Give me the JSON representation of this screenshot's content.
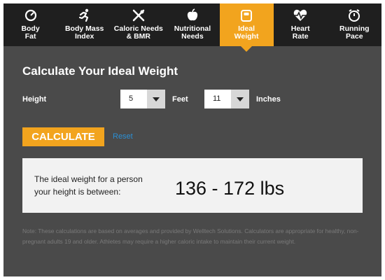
{
  "tabs": [
    {
      "label": "Body\nFat",
      "icon": "scale-icon"
    },
    {
      "label": "Body Mass\nIndex",
      "icon": "runner-icon"
    },
    {
      "label": "Caloric Needs\n& BMR",
      "icon": "utensils-icon"
    },
    {
      "label": "Nutritional\nNeeds",
      "icon": "apple-icon"
    },
    {
      "label": "Ideal\nWeight",
      "icon": "weight-scale-icon",
      "active": true
    },
    {
      "label": "Heart\nRate",
      "icon": "heart-pulse-icon"
    },
    {
      "label": "Running\nPace",
      "icon": "stopwatch-icon"
    }
  ],
  "main": {
    "title": "Calculate Your Ideal Weight",
    "height_label": "Height",
    "feet_value": "5",
    "feet_label": "Feet",
    "inches_value": "11",
    "inches_label": "Inches",
    "calculate_label": "CALCULATE",
    "reset_label": "Reset",
    "result_text": "The ideal weight for a person your height is between:",
    "result_value": "136 - 172 lbs",
    "note": "Note: These calculations are based on averages and provided by Welltech Solutions. Calculators are appropriate for healthy, non-pregnant adults 19 and older. Athletes may require a higher caloric intake to maintain their current weight."
  },
  "colors": {
    "accent": "#f2a41e",
    "tab_bar": "#1f1f1f",
    "panel": "#4a4a4a",
    "link": "#2b8fd4"
  }
}
